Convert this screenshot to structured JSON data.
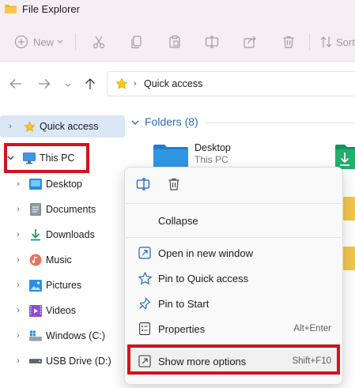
{
  "window": {
    "title": "File Explorer"
  },
  "toolbar": {
    "new_label": "New",
    "sort_label": "Sort"
  },
  "address": {
    "path": "Quick access"
  },
  "sidebar": {
    "items": [
      {
        "label": "Quick access",
        "icon": "star-icon",
        "selected": true
      },
      {
        "label": "This PC",
        "icon": "monitor-icon",
        "expanded": true
      },
      {
        "label": "Desktop",
        "icon": "desktop-folder-icon"
      },
      {
        "label": "Documents",
        "icon": "documents-icon"
      },
      {
        "label": "Downloads",
        "icon": "download-icon"
      },
      {
        "label": "Music",
        "icon": "music-icon"
      },
      {
        "label": "Pictures",
        "icon": "pictures-icon"
      },
      {
        "label": "Videos",
        "icon": "videos-icon"
      },
      {
        "label": "Windows (C:)",
        "icon": "windows-drive-icon"
      },
      {
        "label": "USB Drive (D:)",
        "icon": "usb-drive-icon"
      }
    ]
  },
  "content": {
    "group_label": "Folders (8)",
    "folders": [
      {
        "name": "Desktop",
        "sub": "This PC"
      }
    ]
  },
  "context_menu": {
    "top_actions": [
      "rename-icon",
      "delete-icon"
    ],
    "items": [
      {
        "label": "Collapse",
        "shortcut": ""
      },
      {
        "label": "Open in new window",
        "shortcut": ""
      },
      {
        "label": "Pin to Quick access",
        "shortcut": ""
      },
      {
        "label": "Pin to Start",
        "shortcut": ""
      },
      {
        "label": "Properties",
        "shortcut": "Alt+Enter"
      },
      {
        "label": "Show more options",
        "shortcut": "Shift+F10"
      }
    ]
  },
  "colors": {
    "highlight_box": "#d4121e",
    "accent_blue": "#2a6db5",
    "folder_yellow": "#f3c64b"
  }
}
